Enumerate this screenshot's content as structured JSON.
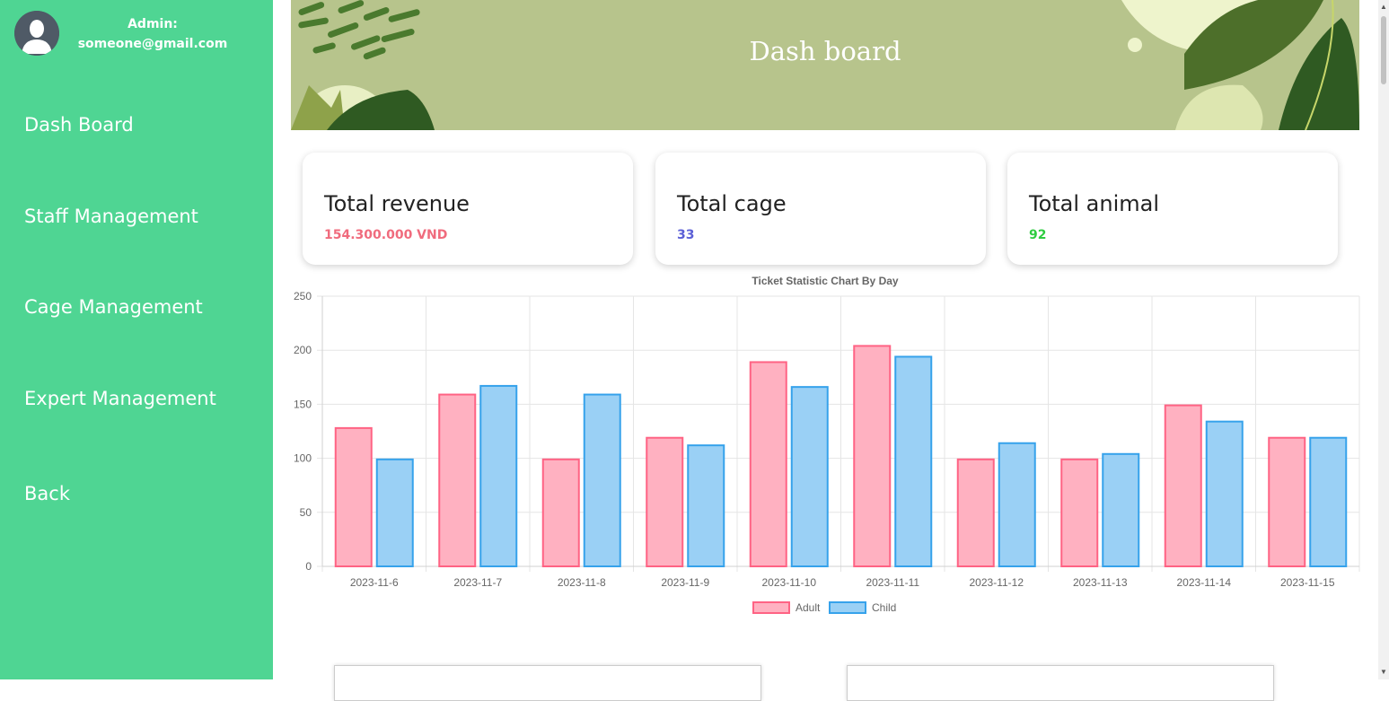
{
  "profile": {
    "label": "Admin:",
    "email": "someone@gmail.com"
  },
  "nav": [
    {
      "label": "Dash Board",
      "icon": ""
    },
    {
      "label": "Staff Management"
    },
    {
      "label": "Cage Management"
    },
    {
      "label": "Expert Management"
    },
    {
      "label": "Back"
    }
  ],
  "banner": {
    "title": "Dash board"
  },
  "stats": [
    {
      "title": "Total revenue",
      "value": "154.300.000 VND",
      "color": "#f06b7d"
    },
    {
      "title": "Total cage",
      "value": "33",
      "color": "#5b5fd6"
    },
    {
      "title": "Total animal",
      "value": "92",
      "color": "#2ecc40"
    }
  ],
  "colors": {
    "sidebar": "#4fd593",
    "banner": "#b7c48c",
    "adult_fill": "#ffb1c1",
    "adult_stroke": "#ff6384",
    "child_fill": "#9ad0f5",
    "child_stroke": "#36a2eb"
  },
  "chart_data": {
    "type": "bar",
    "title": "Ticket Statistic Chart By Day",
    "categories": [
      "2023-11-6",
      "2023-11-7",
      "2023-11-8",
      "2023-11-9",
      "2023-11-10",
      "2023-11-11",
      "2023-11-12",
      "2023-11-13",
      "2023-11-14",
      "2023-11-15"
    ],
    "series": [
      {
        "name": "Adult",
        "values": [
          128,
          159,
          99,
          119,
          189,
          204,
          99,
          99,
          149,
          119
        ]
      },
      {
        "name": "Child",
        "values": [
          99,
          167,
          159,
          112,
          166,
          194,
          114,
          104,
          134,
          119
        ]
      }
    ],
    "ylim": [
      0,
      250
    ],
    "yticks": [
      0,
      50,
      100,
      150,
      200,
      250
    ],
    "grid": true,
    "legend": "bottom"
  }
}
